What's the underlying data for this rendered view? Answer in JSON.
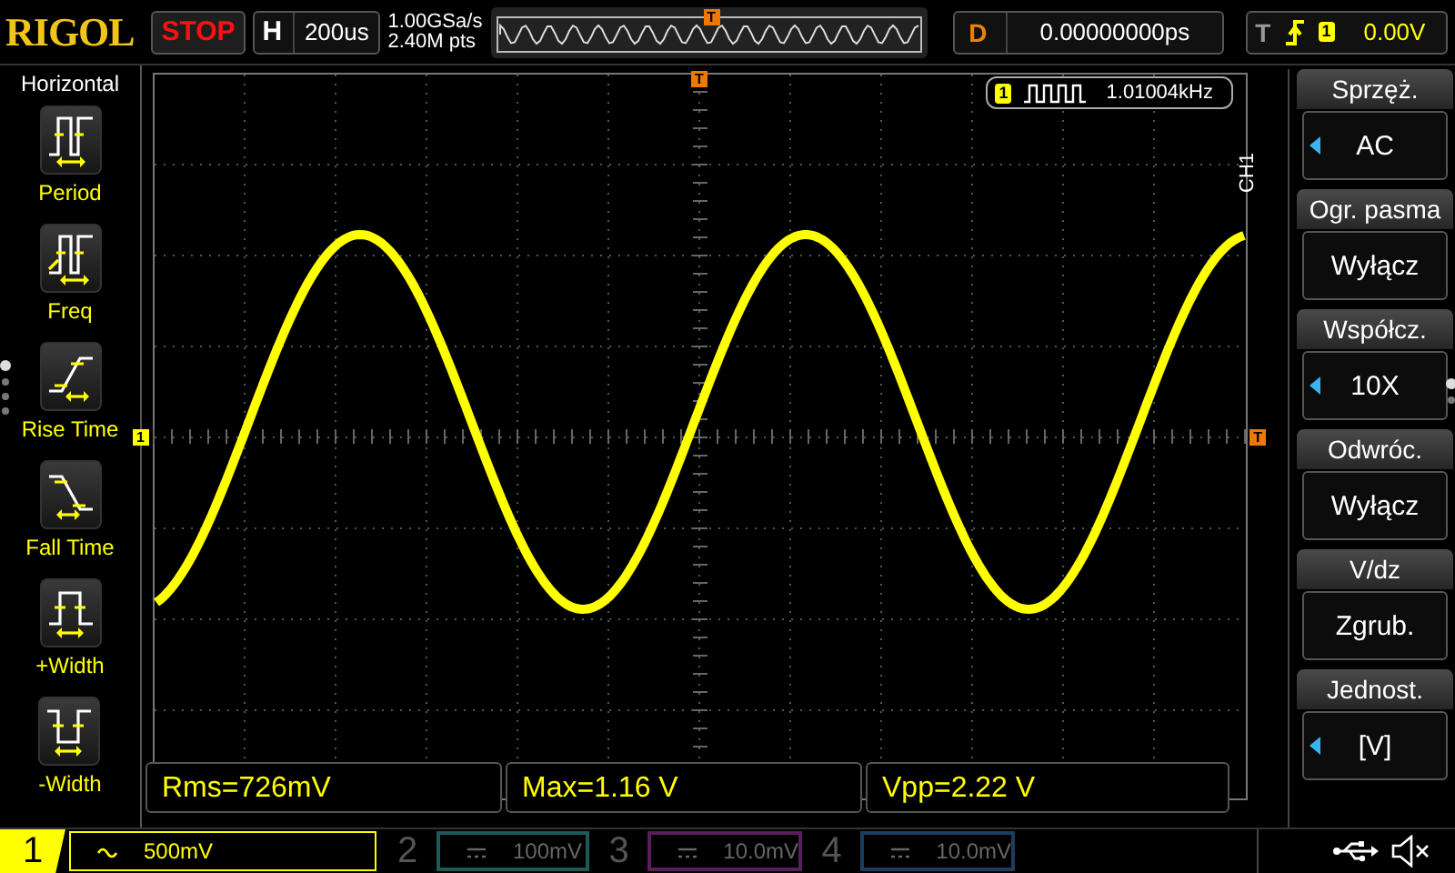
{
  "header": {
    "logo": "RIGOL",
    "run_state": "STOP",
    "timebase": {
      "label": "H",
      "value": "200us"
    },
    "sample_rate": "1.00GSa/s",
    "memory_depth": "2.40M pts",
    "memory_marker": "T",
    "delay": {
      "label": "D",
      "value": "0.00000000ps"
    },
    "trigger": {
      "label": "T",
      "source": "1",
      "level": "0.00V"
    }
  },
  "left_menu": {
    "title": "Horizontal",
    "items": [
      {
        "kind": "period",
        "label": "Period"
      },
      {
        "kind": "freq",
        "label": "Freq"
      },
      {
        "kind": "rise",
        "label": "Rise Time"
      },
      {
        "kind": "fall",
        "label": "Fall Time"
      },
      {
        "kind": "pwidth",
        "label": "+Width"
      },
      {
        "kind": "nwidth",
        "label": "-Width"
      }
    ],
    "pages": [
      {
        "selected": true
      },
      {
        "selected": false
      },
      {
        "selected": false
      },
      {
        "selected": false
      }
    ]
  },
  "display": {
    "channel_marker": "1",
    "trigger_position_marker": "T",
    "trigger_level_marker": "T",
    "frequency_counter": {
      "source": "1",
      "value": "1.01004kHz"
    }
  },
  "measurements": [
    "Rms=726mV",
    "Max=1.16 V",
    "Vpp=2.22 V"
  ],
  "right_menu": {
    "channel": "CH1",
    "items": [
      {
        "label": "Sprzęż.",
        "value": "AC",
        "arrow": true
      },
      {
        "label": "Ogr. pasma",
        "value": "Wyłącz",
        "arrow": false
      },
      {
        "label": "Współcz.",
        "value": "10X",
        "arrow": true
      },
      {
        "label": "Odwróc.",
        "value": "Wyłącz",
        "arrow": false
      },
      {
        "label": "V/dz",
        "value": "Zgrub.",
        "arrow": false
      },
      {
        "label": "Jednost.",
        "value": "[V]",
        "arrow": true
      }
    ],
    "pages": [
      {
        "selected": true
      },
      {
        "selected": false
      }
    ]
  },
  "channels": [
    {
      "number": "1",
      "ac_coupled": true,
      "scale": "500mV",
      "active": true,
      "color": "#ffff00"
    },
    {
      "number": "2",
      "ac_coupled": false,
      "scale": "100mV",
      "active": false,
      "color": "#1e5a5a"
    },
    {
      "number": "3",
      "ac_coupled": false,
      "scale": "10.0mV",
      "active": false,
      "color": "#5a1e5a"
    },
    {
      "number": "4",
      "ac_coupled": false,
      "scale": "10.0mV",
      "active": false,
      "color": "#1e3c5e"
    }
  ]
}
